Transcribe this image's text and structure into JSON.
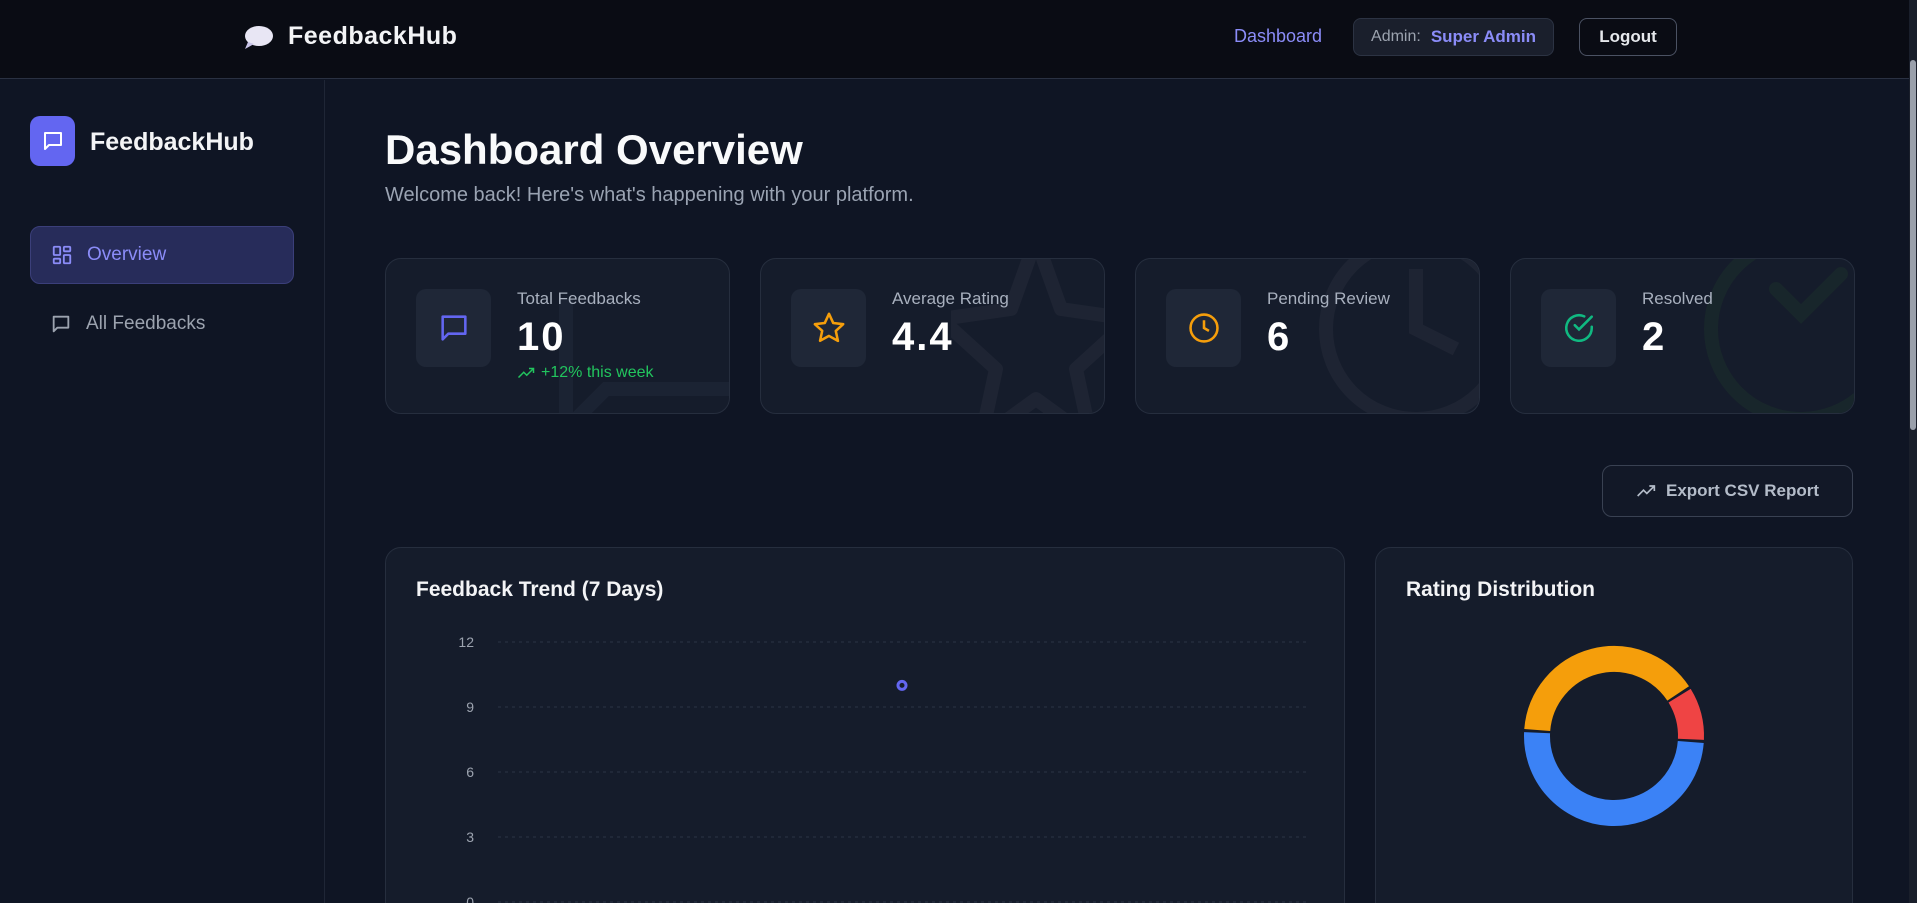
{
  "topbar": {
    "brand": "FeedbackHub",
    "dashboard_link": "Dashboard",
    "admin_label": "Admin:",
    "admin_name": "Super Admin",
    "logout": "Logout"
  },
  "sidebar": {
    "brand": "FeedbackHub",
    "items": [
      {
        "label": "Overview",
        "icon": "grid-icon",
        "active": true
      },
      {
        "label": "All Feedbacks",
        "icon": "message-icon",
        "active": false
      }
    ]
  },
  "main": {
    "title": "Dashboard Overview",
    "subtitle": "Welcome back! Here's what's happening with your platform.",
    "export_label": "Export CSV Report"
  },
  "stats": [
    {
      "label": "Total Feedbacks",
      "value": "10",
      "trend": "+12% this week",
      "icon": "message-icon",
      "color": "#6366f1"
    },
    {
      "label": "Average Rating",
      "value": "4.4",
      "icon": "star-icon",
      "color": "#f59e0b"
    },
    {
      "label": "Pending Review",
      "value": "6",
      "icon": "clock-icon",
      "color": "#f59e0b"
    },
    {
      "label": "Resolved",
      "value": "2",
      "icon": "check-circle-icon",
      "color": "#10b981"
    }
  ],
  "colors": {
    "accent": "#6366f1",
    "accent_text": "#8b8cf8",
    "success": "#22c55e",
    "warning": "#f59e0b",
    "danger": "#ef4444",
    "info": "#3b82f6"
  },
  "chart_data": [
    {
      "type": "line",
      "title": "Feedback Trend (7 Days)",
      "yticks": [
        "12",
        "9",
        "6",
        "3",
        "0"
      ],
      "ylim": [
        0,
        12
      ],
      "points": [
        {
          "x": 3,
          "y": 10
        }
      ],
      "xlim": [
        0,
        6
      ],
      "grid": true,
      "color": "#6366f1"
    },
    {
      "type": "pie",
      "title": "Rating Distribution",
      "donut": true,
      "slices": [
        {
          "value": 5,
          "color": "#3b82f6"
        },
        {
          "value": 4,
          "color": "#f59e0b"
        },
        {
          "value": 1,
          "color": "#ef4444"
        }
      ]
    }
  ]
}
